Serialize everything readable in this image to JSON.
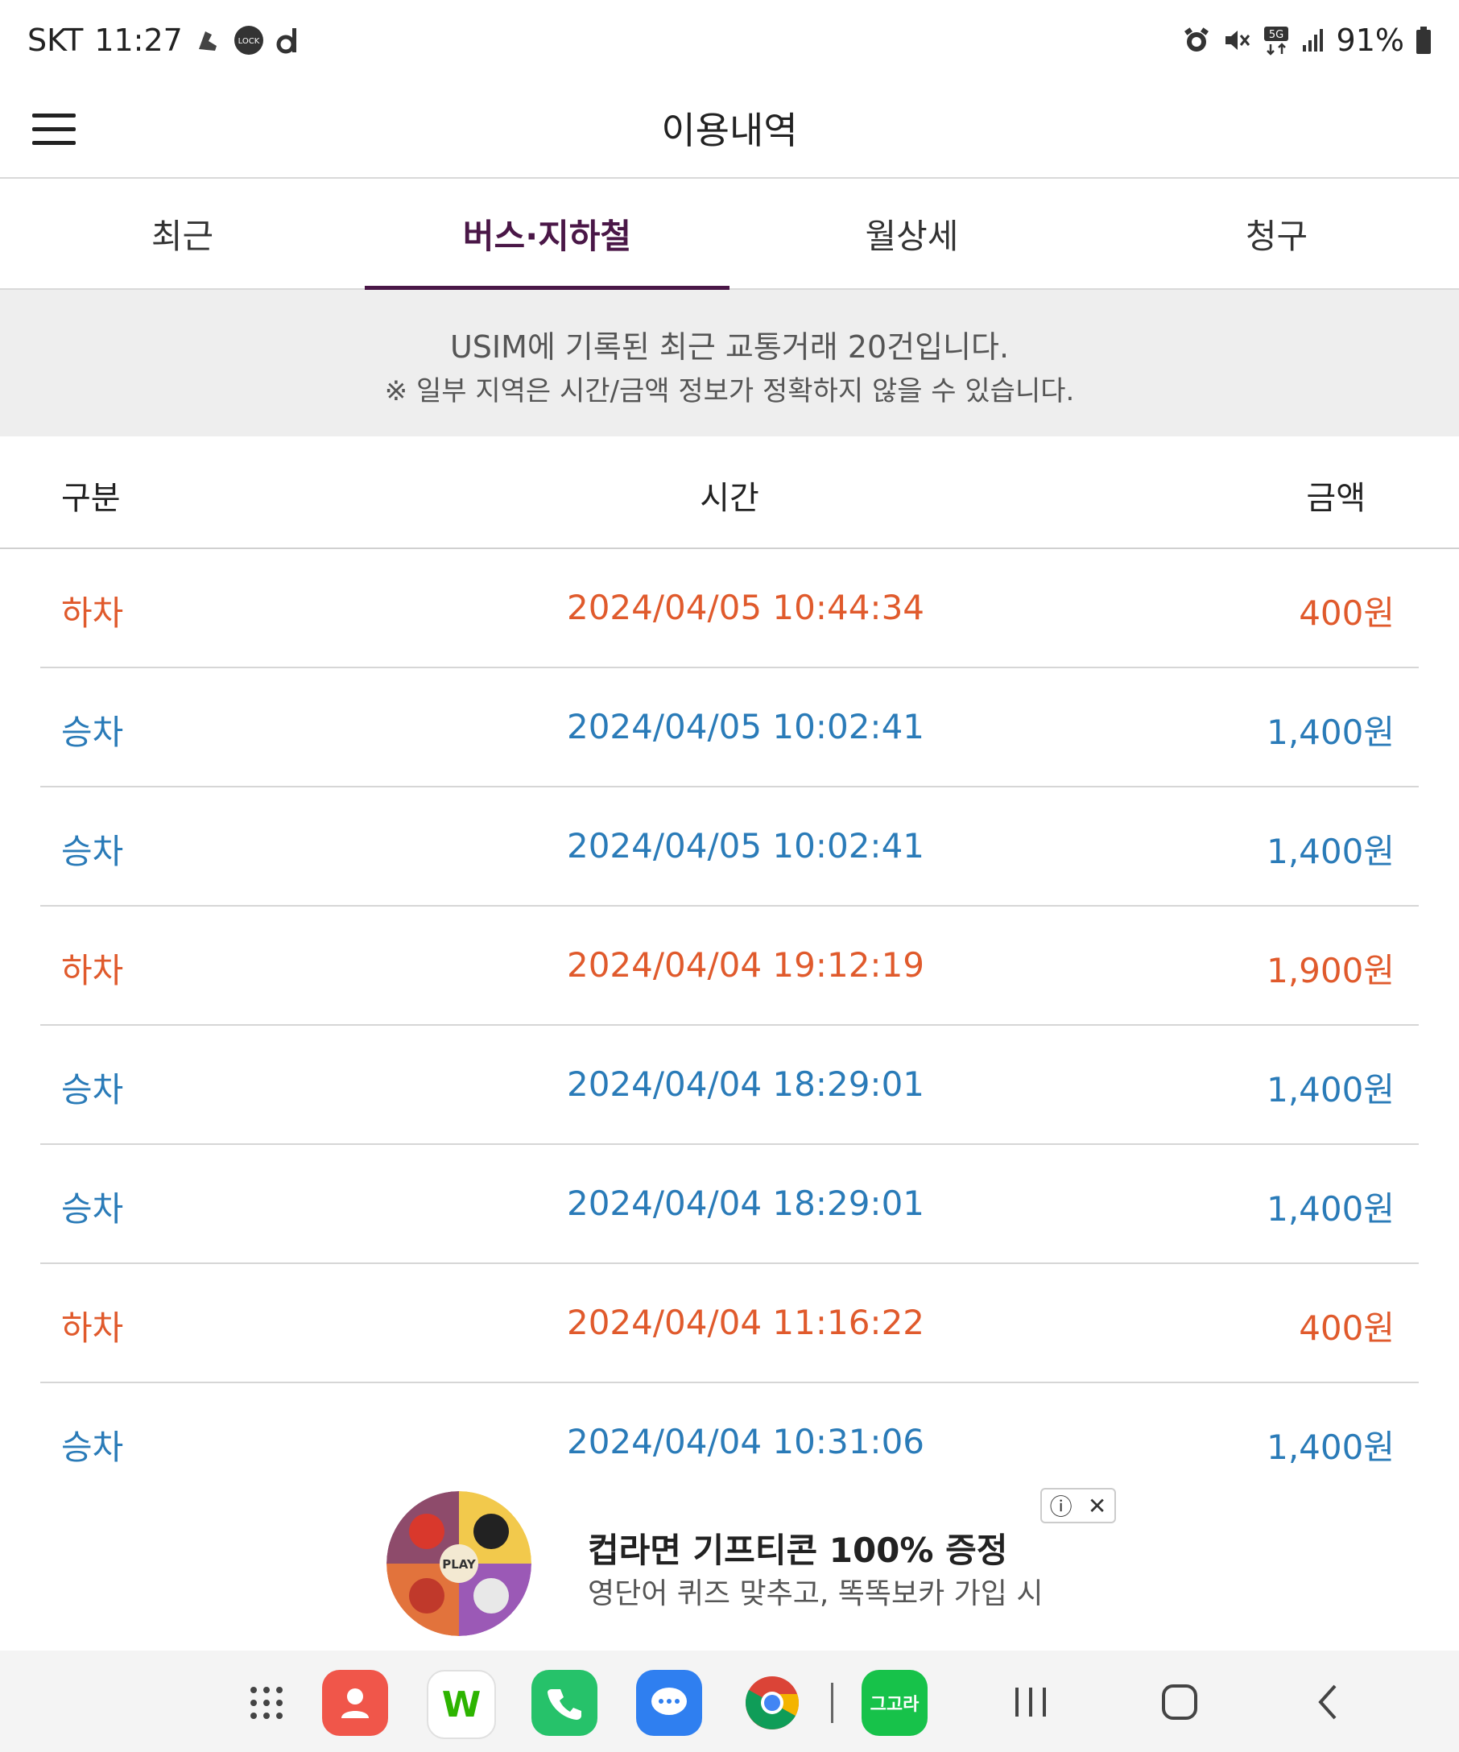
{
  "status_bar": {
    "carrier": "SKT",
    "time": "11:27",
    "battery": "91%",
    "network": "5G"
  },
  "header": {
    "title": "이용내역"
  },
  "tabs": [
    {
      "label": "최근",
      "active": false
    },
    {
      "label": "버스·지하철",
      "active": true
    },
    {
      "label": "월상세",
      "active": false
    },
    {
      "label": "청구",
      "active": false
    }
  ],
  "notice": {
    "line1": "USIM에 기록된 최근 교통거래 20건입니다.",
    "line2": "※ 일부 지역은 시간/금액 정보가 정확하지 않을 수 있습니다."
  },
  "table": {
    "headers": {
      "type": "구분",
      "time": "시간",
      "amount": "금액"
    },
    "rows": [
      {
        "type": "하차",
        "time": "2024/04/05 10:44:34",
        "amount": "400원",
        "kind": "off"
      },
      {
        "type": "승차",
        "time": "2024/04/05 10:02:41",
        "amount": "1,400원",
        "kind": "on"
      },
      {
        "type": "승차",
        "time": "2024/04/05 10:02:41",
        "amount": "1,400원",
        "kind": "on"
      },
      {
        "type": "하차",
        "time": "2024/04/04 19:12:19",
        "amount": "1,900원",
        "kind": "off"
      },
      {
        "type": "승차",
        "time": "2024/04/04 18:29:01",
        "amount": "1,400원",
        "kind": "on"
      },
      {
        "type": "승차",
        "time": "2024/04/04 18:29:01",
        "amount": "1,400원",
        "kind": "on"
      },
      {
        "type": "하차",
        "time": "2024/04/04 11:16:22",
        "amount": "400원",
        "kind": "off"
      },
      {
        "type": "승차",
        "time": "2024/04/04 10:31:06",
        "amount": "1,400원",
        "kind": "on"
      }
    ]
  },
  "ad": {
    "title": "컵라면 기프티콘 100% 증정",
    "subtitle": "영단어 퀴즈 맞추고, 똑똑보카 가입 시",
    "play_label": "PLAY"
  },
  "nav_apps": [
    {
      "name": "apps-grid-icon"
    },
    {
      "name": "contacts-icon",
      "color": "#f0564a"
    },
    {
      "name": "naver-webtoon-icon",
      "color": "#ffffff",
      "label": "W"
    },
    {
      "name": "phone-icon",
      "color": "#26c26a"
    },
    {
      "name": "messages-icon",
      "color": "#2f7ff0"
    },
    {
      "name": "chrome-icon"
    },
    {
      "name": "gogora-icon",
      "color": "#17c24a",
      "label": "그고라"
    }
  ],
  "colors": {
    "accent": "#4a1747",
    "alight_off": "#e05a2c",
    "board_on": "#2a7bb8"
  }
}
